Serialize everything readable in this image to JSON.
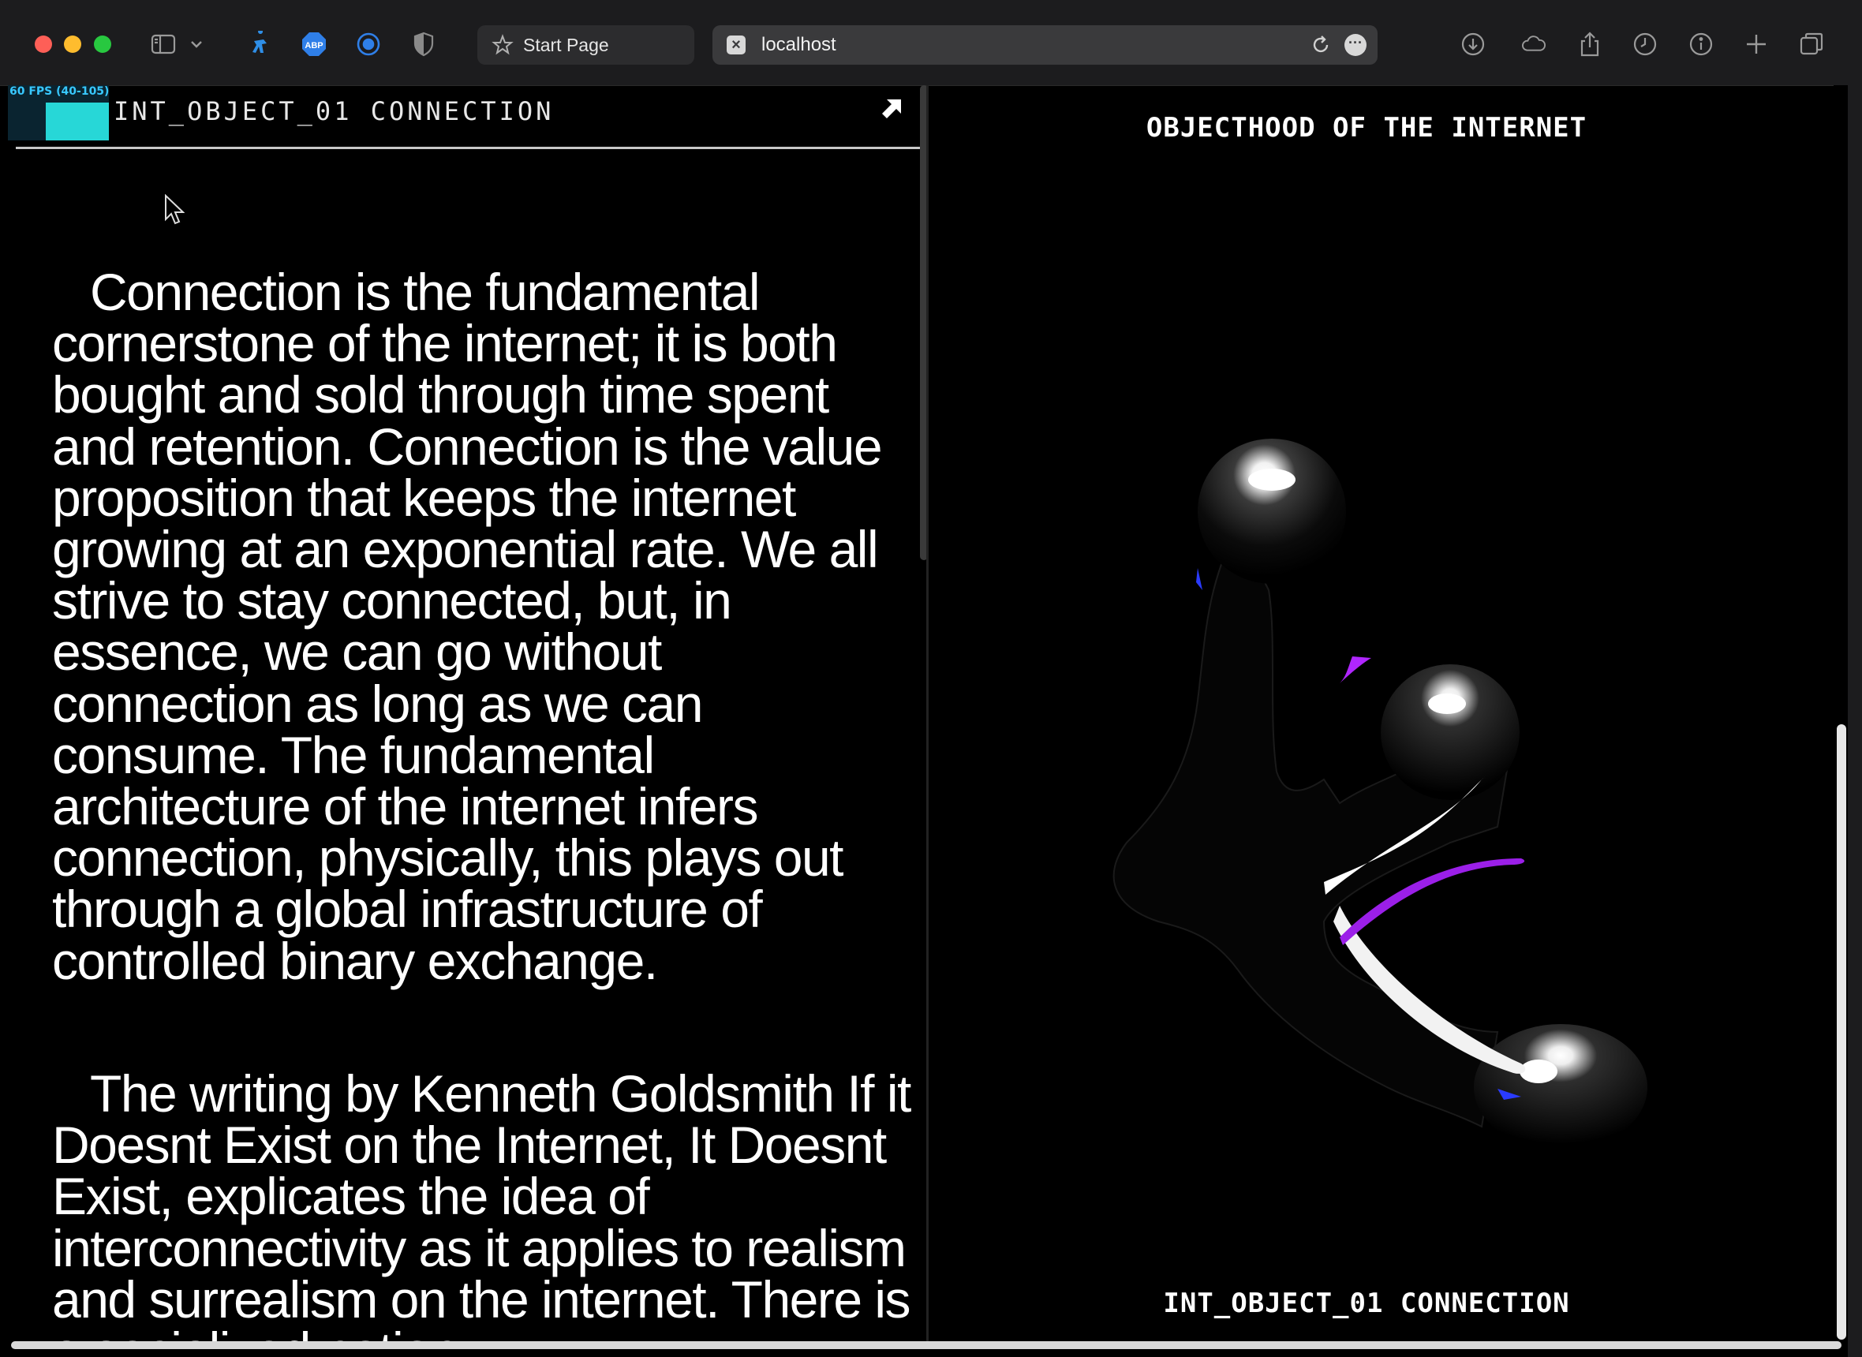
{
  "browser": {
    "tabs": [
      {
        "label": "Start Page",
        "icon": "star-icon"
      },
      {
        "label": "localhost",
        "icon": "tab-close-icon"
      }
    ],
    "toolbar_icons": [
      "sidebar-icon",
      "chevron-down-icon",
      "extension-figure-icon",
      "adblock-icon",
      "extension-target-icon",
      "shield-icon",
      "download-icon",
      "cloud-icon",
      "share-icon",
      "history-icon",
      "info-icon",
      "plus-icon",
      "tabs-overview-icon"
    ],
    "extension_labels": {
      "adblock": "ABP"
    }
  },
  "left_panel": {
    "fps_text": "60 FPS (40-105)",
    "heading": "INT_OBJECT_01 CONNECTION",
    "paragraphs": [
      "Connection is the fundamental cornerstone of the internet; it is both bought and sold through time spent and retention. Connection is the value proposition that keeps the internet growing at an exponential rate. We all strive to stay connected, but, in essence, we can go without connection as long as we can consume. The fundamental architecture of the internet infers connection, physically, this plays out through a global infrastructure of controlled binary exchange.",
      "The writing by Kenneth Goldsmith If it Doesnt Exist on the Internet, It Doesnt Exist, explicates the idea of interconnectivity as it applies to realism and surrealism on the internet. There is a socialized notion"
    ]
  },
  "right_panel": {
    "title": "OBJECTHOOD OF THE INTERNET",
    "footer": "INT_OBJECT_01 CONNECTION"
  },
  "colors": {
    "background": "#000000",
    "toolbar": "#1c1c1e",
    "fps_graph": "#27d7d7",
    "accent_purple": "#b026ff",
    "accent_blue": "#2a3bff"
  }
}
